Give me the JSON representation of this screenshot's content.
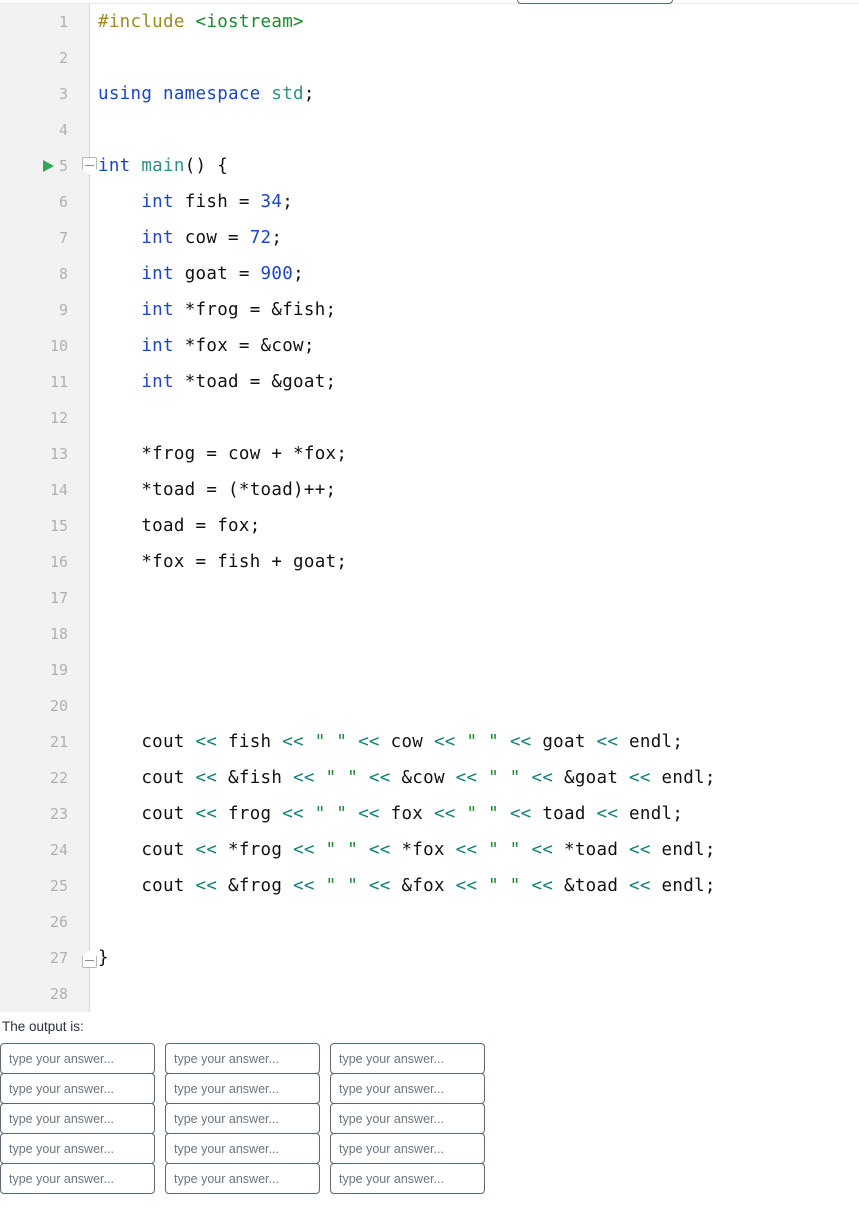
{
  "editor": {
    "language": "C++",
    "gutter_color": "#f2f2f2",
    "run_marker_line": 5,
    "fold_open_line": 5,
    "fold_close_line": 27,
    "lines": [
      {
        "n": "1",
        "tokens": [
          {
            "t": "#include ",
            "c": "t-pre"
          },
          {
            "t": "<iostream>",
            "c": "t-inc"
          }
        ]
      },
      {
        "n": "2",
        "tokens": []
      },
      {
        "n": "3",
        "tokens": [
          {
            "t": "using namespace ",
            "c": "t-kw"
          },
          {
            "t": "std",
            "c": "t-type"
          },
          {
            "t": ";",
            "c": "t-plain"
          }
        ]
      },
      {
        "n": "4",
        "tokens": []
      },
      {
        "n": "5",
        "tokens": [
          {
            "t": "int ",
            "c": "t-kw"
          },
          {
            "t": "main",
            "c": "t-type"
          },
          {
            "t": "() {",
            "c": "t-plain"
          }
        ]
      },
      {
        "n": "6",
        "tokens": [
          {
            "t": "    ",
            "c": "t-plain"
          },
          {
            "t": "int ",
            "c": "t-kw"
          },
          {
            "t": "fish = ",
            "c": "t-plain"
          },
          {
            "t": "34",
            "c": "t-num"
          },
          {
            "t": ";",
            "c": "t-plain"
          }
        ]
      },
      {
        "n": "7",
        "tokens": [
          {
            "t": "    ",
            "c": "t-plain"
          },
          {
            "t": "int ",
            "c": "t-kw"
          },
          {
            "t": "cow = ",
            "c": "t-plain"
          },
          {
            "t": "72",
            "c": "t-num"
          },
          {
            "t": ";",
            "c": "t-plain"
          }
        ]
      },
      {
        "n": "8",
        "tokens": [
          {
            "t": "    ",
            "c": "t-plain"
          },
          {
            "t": "int ",
            "c": "t-kw"
          },
          {
            "t": "goat = ",
            "c": "t-plain"
          },
          {
            "t": "900",
            "c": "t-num"
          },
          {
            "t": ";",
            "c": "t-plain"
          }
        ]
      },
      {
        "n": "9",
        "tokens": [
          {
            "t": "    ",
            "c": "t-plain"
          },
          {
            "t": "int ",
            "c": "t-kw"
          },
          {
            "t": "*frog = &fish;",
            "c": "t-plain"
          }
        ]
      },
      {
        "n": "10",
        "tokens": [
          {
            "t": "    ",
            "c": "t-plain"
          },
          {
            "t": "int ",
            "c": "t-kw"
          },
          {
            "t": "*fox = &cow;",
            "c": "t-plain"
          }
        ]
      },
      {
        "n": "11",
        "tokens": [
          {
            "t": "    ",
            "c": "t-plain"
          },
          {
            "t": "int ",
            "c": "t-kw"
          },
          {
            "t": "*toad = &goat;",
            "c": "t-plain"
          }
        ]
      },
      {
        "n": "12",
        "tokens": []
      },
      {
        "n": "13",
        "tokens": [
          {
            "t": "    *frog = cow + *fox;",
            "c": "t-plain"
          }
        ]
      },
      {
        "n": "14",
        "tokens": [
          {
            "t": "    *toad = (*toad)++;",
            "c": "t-plain"
          }
        ]
      },
      {
        "n": "15",
        "tokens": [
          {
            "t": "    toad = fox;",
            "c": "t-plain"
          }
        ]
      },
      {
        "n": "16",
        "tokens": [
          {
            "t": "    *fox = fish + goat;",
            "c": "t-plain"
          }
        ]
      },
      {
        "n": "17",
        "tokens": []
      },
      {
        "n": "18",
        "tokens": []
      },
      {
        "n": "19",
        "tokens": []
      },
      {
        "n": "20",
        "tokens": []
      },
      {
        "n": "21",
        "tokens": [
          {
            "t": "    cout ",
            "c": "t-plain"
          },
          {
            "t": "<< ",
            "c": "t-op"
          },
          {
            "t": "fish ",
            "c": "t-plain"
          },
          {
            "t": "<< ",
            "c": "t-op"
          },
          {
            "t": "\" \" ",
            "c": "t-str"
          },
          {
            "t": "<< ",
            "c": "t-op"
          },
          {
            "t": "cow ",
            "c": "t-plain"
          },
          {
            "t": "<< ",
            "c": "t-op"
          },
          {
            "t": "\" \" ",
            "c": "t-str"
          },
          {
            "t": "<< ",
            "c": "t-op"
          },
          {
            "t": "goat ",
            "c": "t-plain"
          },
          {
            "t": "<< ",
            "c": "t-op"
          },
          {
            "t": "endl;",
            "c": "t-plain"
          }
        ]
      },
      {
        "n": "22",
        "tokens": [
          {
            "t": "    cout ",
            "c": "t-plain"
          },
          {
            "t": "<< ",
            "c": "t-op"
          },
          {
            "t": "&fish ",
            "c": "t-plain"
          },
          {
            "t": "<< ",
            "c": "t-op"
          },
          {
            "t": "\" \" ",
            "c": "t-str"
          },
          {
            "t": "<< ",
            "c": "t-op"
          },
          {
            "t": "&cow ",
            "c": "t-plain"
          },
          {
            "t": "<< ",
            "c": "t-op"
          },
          {
            "t": "\" \" ",
            "c": "t-str"
          },
          {
            "t": "<< ",
            "c": "t-op"
          },
          {
            "t": "&goat ",
            "c": "t-plain"
          },
          {
            "t": "<< ",
            "c": "t-op"
          },
          {
            "t": "endl;",
            "c": "t-plain"
          }
        ]
      },
      {
        "n": "23",
        "tokens": [
          {
            "t": "    cout ",
            "c": "t-plain"
          },
          {
            "t": "<< ",
            "c": "t-op"
          },
          {
            "t": "frog ",
            "c": "t-plain"
          },
          {
            "t": "<< ",
            "c": "t-op"
          },
          {
            "t": "\" \" ",
            "c": "t-str"
          },
          {
            "t": "<< ",
            "c": "t-op"
          },
          {
            "t": "fox ",
            "c": "t-plain"
          },
          {
            "t": "<< ",
            "c": "t-op"
          },
          {
            "t": "\" \" ",
            "c": "t-str"
          },
          {
            "t": "<< ",
            "c": "t-op"
          },
          {
            "t": "toad ",
            "c": "t-plain"
          },
          {
            "t": "<< ",
            "c": "t-op"
          },
          {
            "t": "endl;",
            "c": "t-plain"
          }
        ]
      },
      {
        "n": "24",
        "tokens": [
          {
            "t": "    cout ",
            "c": "t-plain"
          },
          {
            "t": "<< ",
            "c": "t-op"
          },
          {
            "t": "*frog ",
            "c": "t-plain"
          },
          {
            "t": "<< ",
            "c": "t-op"
          },
          {
            "t": "\" \" ",
            "c": "t-str"
          },
          {
            "t": "<< ",
            "c": "t-op"
          },
          {
            "t": "*fox ",
            "c": "t-plain"
          },
          {
            "t": "<< ",
            "c": "t-op"
          },
          {
            "t": "\" \" ",
            "c": "t-str"
          },
          {
            "t": "<< ",
            "c": "t-op"
          },
          {
            "t": "*toad ",
            "c": "t-plain"
          },
          {
            "t": "<< ",
            "c": "t-op"
          },
          {
            "t": "endl;",
            "c": "t-plain"
          }
        ]
      },
      {
        "n": "25",
        "tokens": [
          {
            "t": "    cout ",
            "c": "t-plain"
          },
          {
            "t": "<< ",
            "c": "t-op"
          },
          {
            "t": "&frog ",
            "c": "t-plain"
          },
          {
            "t": "<< ",
            "c": "t-op"
          },
          {
            "t": "\" \" ",
            "c": "t-str"
          },
          {
            "t": "<< ",
            "c": "t-op"
          },
          {
            "t": "&fox ",
            "c": "t-plain"
          },
          {
            "t": "<< ",
            "c": "t-op"
          },
          {
            "t": "\" \" ",
            "c": "t-str"
          },
          {
            "t": "<< ",
            "c": "t-op"
          },
          {
            "t": "&toad ",
            "c": "t-plain"
          },
          {
            "t": "<< ",
            "c": "t-op"
          },
          {
            "t": "endl;",
            "c": "t-plain"
          }
        ]
      },
      {
        "n": "26",
        "tokens": []
      },
      {
        "n": "27",
        "tokens": [
          {
            "t": "}",
            "c": "t-plain"
          }
        ]
      },
      {
        "n": "28",
        "tokens": []
      }
    ]
  },
  "answer_section": {
    "label": "The output is:",
    "placeholder": "type your answer...",
    "columns": 3,
    "rows": 5,
    "inputs": [
      {
        "value": ""
      },
      {
        "value": ""
      },
      {
        "value": ""
      },
      {
        "value": ""
      },
      {
        "value": ""
      },
      {
        "value": ""
      },
      {
        "value": ""
      },
      {
        "value": ""
      },
      {
        "value": ""
      },
      {
        "value": ""
      },
      {
        "value": ""
      },
      {
        "value": ""
      },
      {
        "value": ""
      },
      {
        "value": ""
      },
      {
        "value": ""
      }
    ]
  }
}
